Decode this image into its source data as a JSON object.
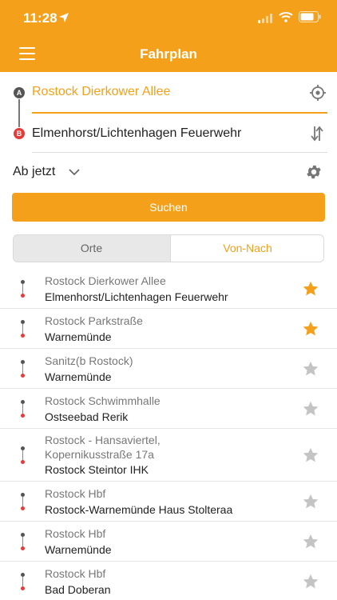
{
  "status_bar": {
    "time": "11:28"
  },
  "nav": {
    "title": "Fahrplan"
  },
  "route": {
    "from_badge": "A",
    "to_badge": "B",
    "from": "Rostock Dierkower Allee",
    "to": "Elmenhorst/Lichtenhagen Feuerwehr"
  },
  "time_selector": {
    "label": "Ab jetzt"
  },
  "search_button": {
    "label": "Suchen"
  },
  "segments": {
    "orte": "Orte",
    "von_nach": "Von-Nach",
    "selected": "Von-Nach"
  },
  "colors": {
    "accent": "#f5a01a",
    "favorite_star": "#f5a01a",
    "inactive_star": "#c4c4c4",
    "from_dot": "#555555",
    "to_dot": "#e43b3b"
  },
  "history": [
    {
      "from": "Rostock Dierkower Allee",
      "to": "Elmenhorst/Lichtenhagen Feuerwehr",
      "favorite": true
    },
    {
      "from": "Rostock Parkstraße",
      "to": "Warnemünde",
      "favorite": true
    },
    {
      "from": "Sanitz(b Rostock)",
      "to": "Warnemünde",
      "favorite": false
    },
    {
      "from": "Rostock Schwimmhalle",
      "to": "Ostseebad Rerik",
      "favorite": false
    },
    {
      "from": "Rostock - Hansaviertel, Kopernikusstraße 17a",
      "to": "Rostock Steintor IHK",
      "favorite": false
    },
    {
      "from": "Rostock Hbf",
      "to": "Rostock-Warnemünde Haus Stolteraa",
      "favorite": false
    },
    {
      "from": "Rostock Hbf",
      "to": "Warnemünde",
      "favorite": false
    },
    {
      "from": "Rostock Hbf",
      "to": "Bad Doberan",
      "favorite": false
    }
  ]
}
